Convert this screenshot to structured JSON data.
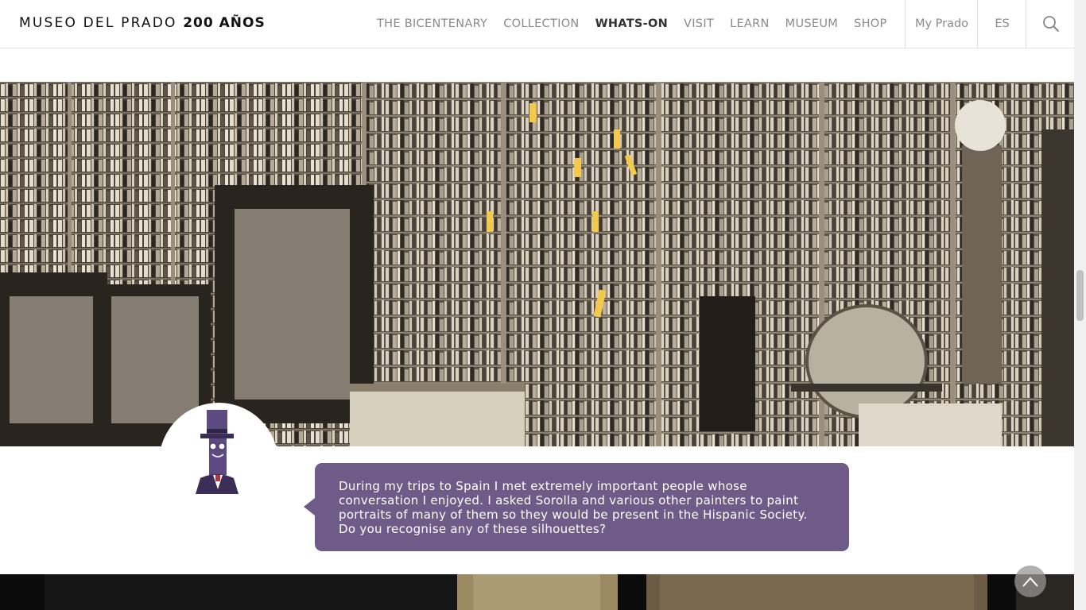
{
  "header": {
    "logo_text": "MUSEO DEL PRADO",
    "logo_bold": "200 AÑOS",
    "nav": [
      {
        "label": "THE BICENTENARY",
        "active": false
      },
      {
        "label": "COLLECTION",
        "active": false
      },
      {
        "label": "WHATS-ON",
        "active": true
      },
      {
        "label": "VISIT",
        "active": false
      },
      {
        "label": "LEARN",
        "active": false
      },
      {
        "label": "MUSEUM",
        "active": false
      },
      {
        "label": "SHOP",
        "active": false
      }
    ],
    "my_prado": "My Prado",
    "language": "ES",
    "search_icon": "search-icon"
  },
  "hero": {
    "image": "library-photograph",
    "highlight_color": "#f2c94c"
  },
  "character": {
    "icon": "top-hat-character-icon"
  },
  "speech_bubble": {
    "text": "During my trips to Spain I met extremely important people whose conversation I enjoyed. I asked Sorolla and various other painters to paint portraits of many of them so they would be present in the Hispanic Society. Do you recognise any of these silhouettes?",
    "color": "#6e5b88"
  },
  "scroll_top": {
    "icon": "arrow-up-icon"
  }
}
